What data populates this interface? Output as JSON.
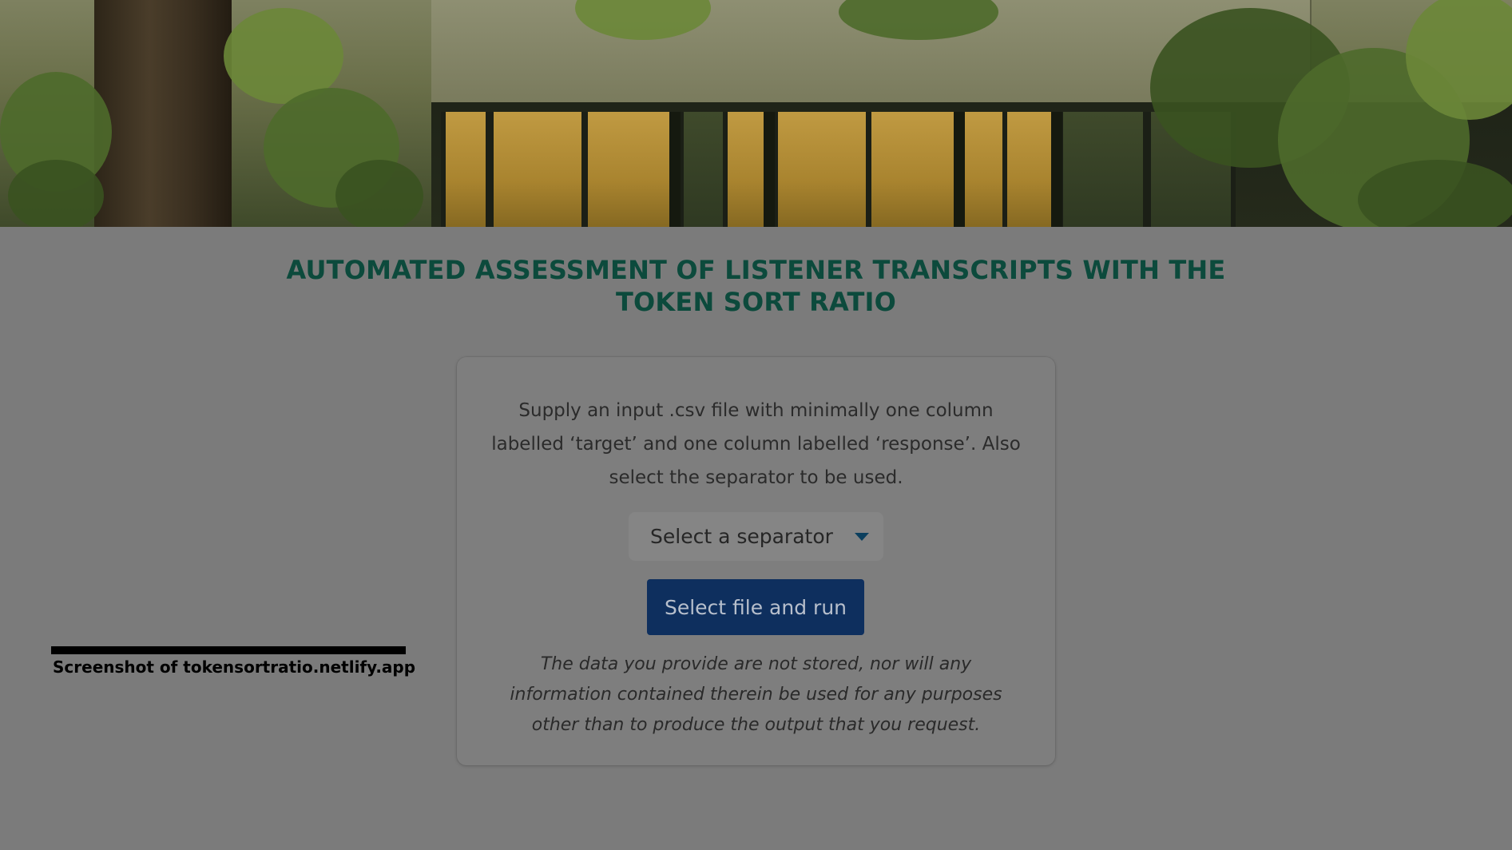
{
  "hero": {
    "image_alt": "Trees in front of a glass building"
  },
  "page": {
    "title_line1": "AUTOMATED ASSESSMENT OF LISTENER TRANSCRIPTS WITH THE",
    "title_line2": "TOKEN SORT RATIO"
  },
  "card": {
    "instructions": "Supply an input .csv file with minimally one column labelled ‘target’ and one column labelled ‘response’. Also select the separator to be used.",
    "separator_select": {
      "placeholder": "Select a separator",
      "caret_icon": "chevron-down-icon"
    },
    "run_button_label": "Select file and run",
    "privacy_note": "The data you provide are not stored, nor will any information contained therein be used for any purposes other than to produce the output that you request."
  },
  "caption": {
    "text": "Screenshot of tokensortratio.netlify.app"
  },
  "colors": {
    "overlay_background": "#7b7b7b",
    "title": "#0c4a3c",
    "button_background": "#0e2f5e",
    "button_text": "#b7bfcc",
    "caret": "#0b3f5e"
  }
}
